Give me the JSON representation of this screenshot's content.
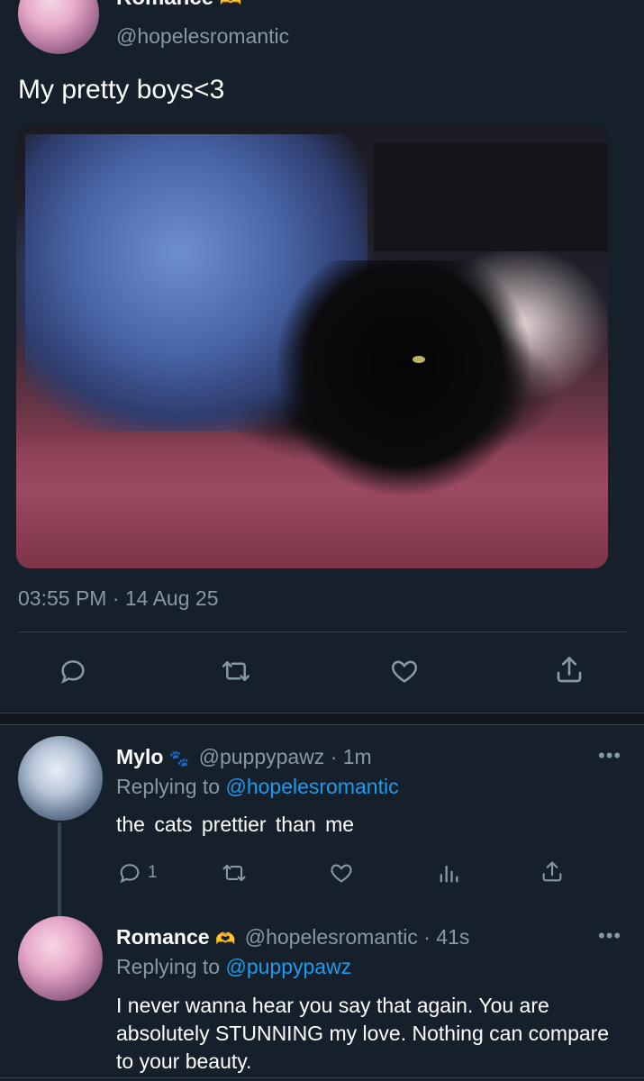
{
  "original_tweet": {
    "display_name": "Romance",
    "handle": "@hopelesromantic",
    "text": "My pretty boys<3",
    "image_alt": "Person with blue hair lying with a black cat on a pink blanket",
    "timestamp": "03:55 PM · 14 Aug 25"
  },
  "actions": {
    "reply_icon": "reply-icon",
    "retweet_icon": "retweet-icon",
    "like_icon": "heart-icon",
    "share_icon": "share-icon"
  },
  "replies": [
    {
      "display_name": "Mylo",
      "badge": "🐾",
      "handle": "@puppypawz",
      "time": "· 1m",
      "replying_prefix": "Replying to",
      "replying_to": "@hopelesromantic",
      "text": "the cats prettier than me",
      "reply_count": "1"
    },
    {
      "display_name": "Romance",
      "handle": "@hopelesromantic",
      "time": "· 41s",
      "replying_prefix": "Replying to",
      "replying_to": "@puppypawz",
      "text": "I never wanna hear you say that again. You are absolutely STUNNING my love. Nothing can compare to your beauty."
    }
  ],
  "colors": {
    "background": "#15202b",
    "muted": "#8899a6",
    "link": "#1d9bf0",
    "divider": "#38444d"
  }
}
